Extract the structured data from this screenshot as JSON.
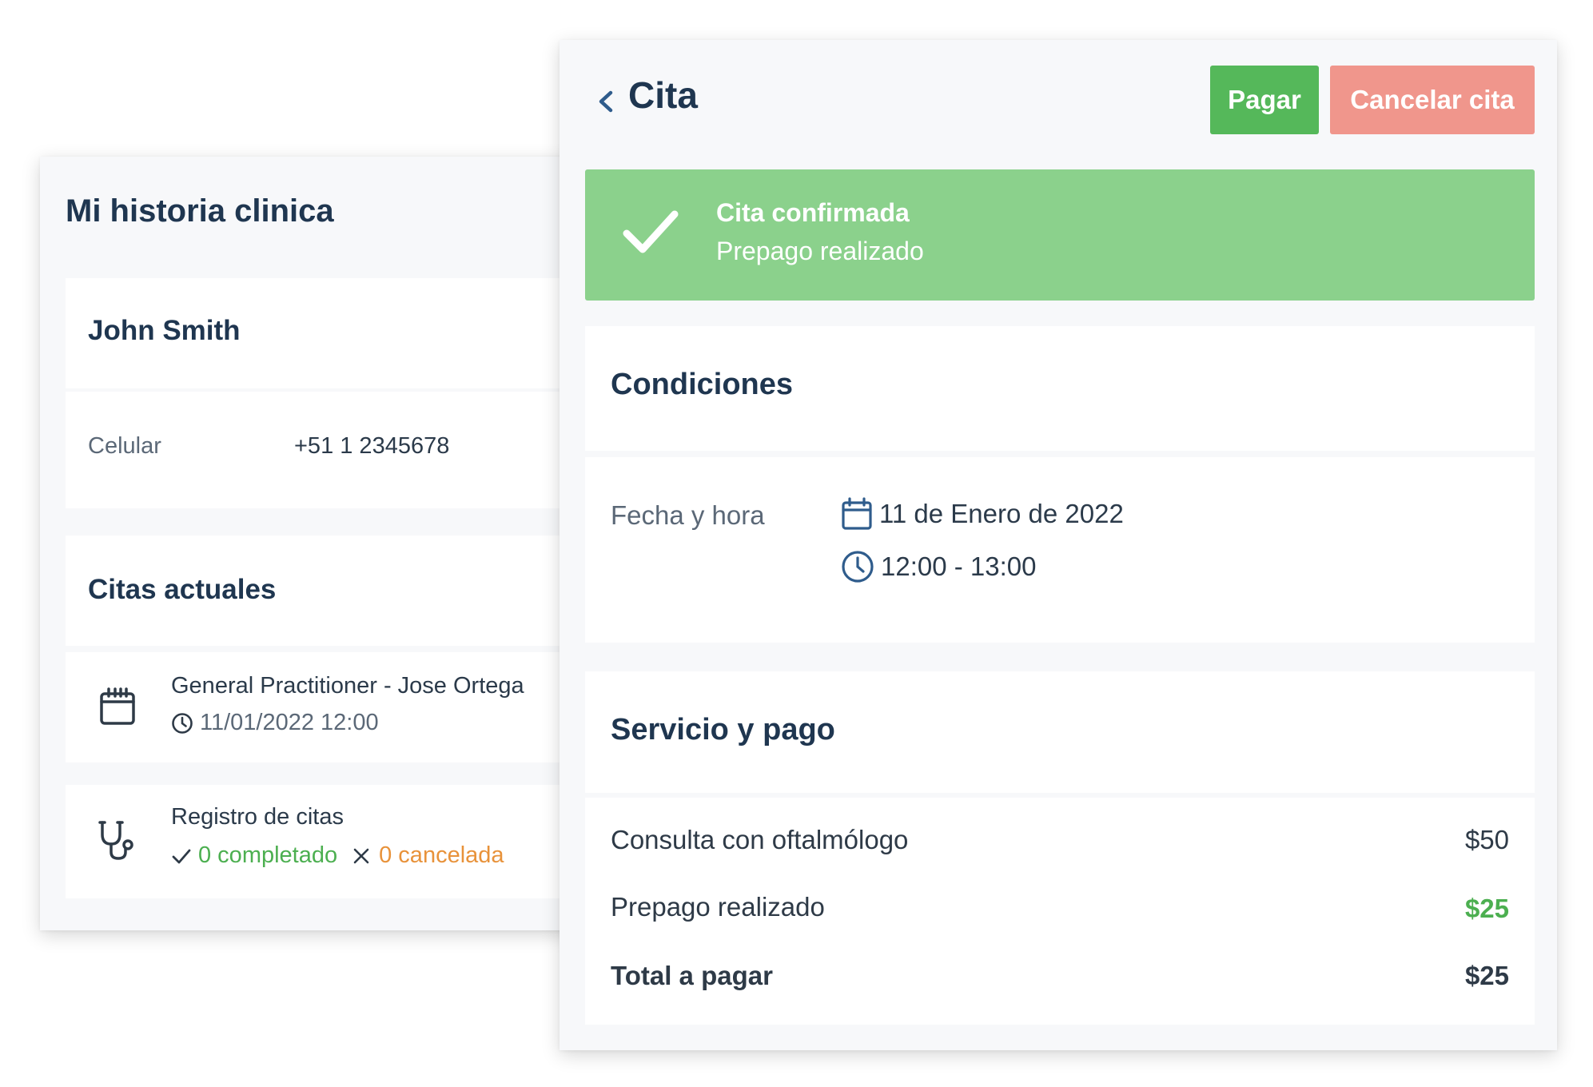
{
  "left_panel": {
    "title": "Mi historia clinica",
    "patient": {
      "name": "John Smith",
      "phone_label": "Celular",
      "phone_value": "+51 1 2345678"
    },
    "current_appointments": {
      "title": "Citas actuales",
      "item": {
        "title": "General Practitioner - Jose Ortega",
        "datetime": "11/01/2022 12:00"
      }
    },
    "registry": {
      "title": "Registro de citas",
      "completed": "0 completado",
      "cancelled": "0 cancelada"
    }
  },
  "right_panel": {
    "title": "Cita",
    "buttons": {
      "pay": "Pagar",
      "cancel": "Cancelar cita"
    },
    "banner": {
      "title": "Cita confirmada",
      "subtitle": "Prepago realizado"
    },
    "conditions": {
      "title": "Condiciones",
      "date_label": "Fecha y hora",
      "date": "11 de Enero de 2022",
      "time": "12:00 - 13:00"
    },
    "service": {
      "title": "Servicio y pago",
      "items": [
        {
          "label": "Consulta con oftalmólogo",
          "value": "$50"
        },
        {
          "label": "Prepago realizado",
          "value": "$25"
        }
      ],
      "total_label": "Total a pagar",
      "total_value": "$25"
    }
  },
  "colors": {
    "pay_button": "#55b85a",
    "cancel_button": "#f0968c",
    "banner": "#8bd18c",
    "heading": "#1f3650",
    "positive": "#4caf50",
    "warning": "#e8923a"
  },
  "icons": [
    "calendar-icon",
    "clock-icon",
    "stethoscope-icon",
    "check-icon",
    "close-icon",
    "chevron-left-icon"
  ]
}
